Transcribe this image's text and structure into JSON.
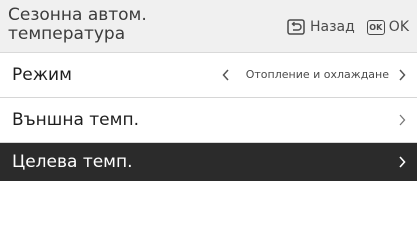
{
  "header": {
    "title_line1": "Сезонна автом.",
    "title_line2": "температура",
    "back_label": "Назад",
    "ok_icon_text": "OK",
    "ok_label": "OK"
  },
  "menu": {
    "items": [
      {
        "label": "Режим",
        "value": "Отопление и охлаждане",
        "selected": false
      },
      {
        "label": "Външна темп.",
        "value": "",
        "selected": false
      },
      {
        "label": "Целева темп.",
        "value": "",
        "selected": true
      }
    ]
  },
  "colors": {
    "header_bg": "#f0f0f0",
    "selected_row_bg": "#2b2b2b",
    "text": "#1e1e1e",
    "divider": "#d6d6d6"
  }
}
